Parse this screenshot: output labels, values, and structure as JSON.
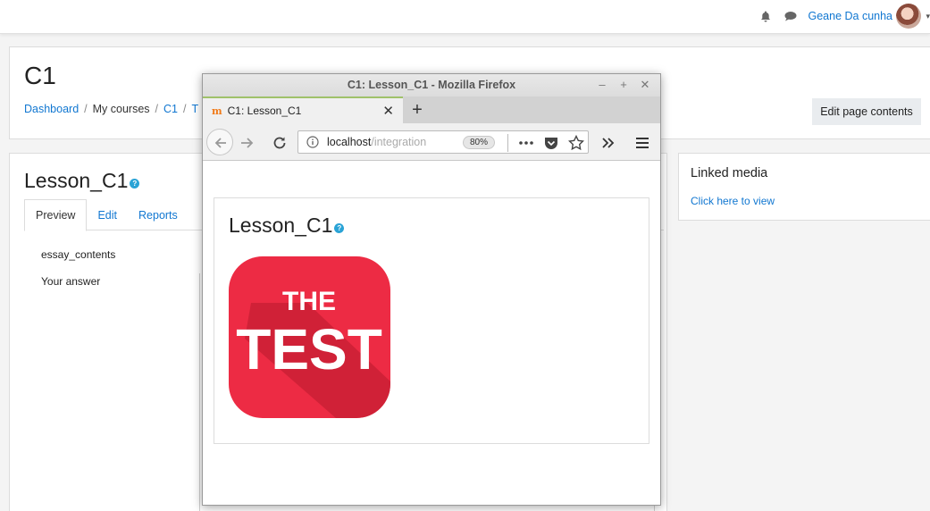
{
  "navbar": {
    "user_name": "Geane Da cunha",
    "icons": [
      "bell-icon",
      "chat-icon"
    ]
  },
  "header": {
    "title": "C1",
    "breadcrumb": [
      {
        "label": "Dashboard",
        "link": true
      },
      {
        "label": "My courses",
        "link": false
      },
      {
        "label": "C1",
        "link": true
      },
      {
        "label": "T",
        "link": true
      }
    ],
    "edit_button": "Edit page contents"
  },
  "lesson": {
    "title": "Lesson_C1",
    "tabs": [
      {
        "label": "Preview",
        "active": true
      },
      {
        "label": "Edit",
        "active": false
      },
      {
        "label": "Reports",
        "active": false
      }
    ],
    "essay": "essay_contents",
    "your_answer": "Your answer"
  },
  "side": {
    "title": "Linked media",
    "link": "Click here to view"
  },
  "firefox": {
    "window_title": "C1: Lesson_C1 - Mozilla Firefox",
    "tab_label": "C1: Lesson_C1",
    "url_host": "localhost",
    "url_path": "/integration",
    "zoom": "80%",
    "content": {
      "title": "Lesson_C1",
      "logo_line1": "THE",
      "logo_line2": "TEST"
    }
  },
  "colors": {
    "link": "#1177d1",
    "help_icon": "#2aa3d6",
    "logo_red": "#ed2b44",
    "tab_accent": "#9fc16a"
  }
}
